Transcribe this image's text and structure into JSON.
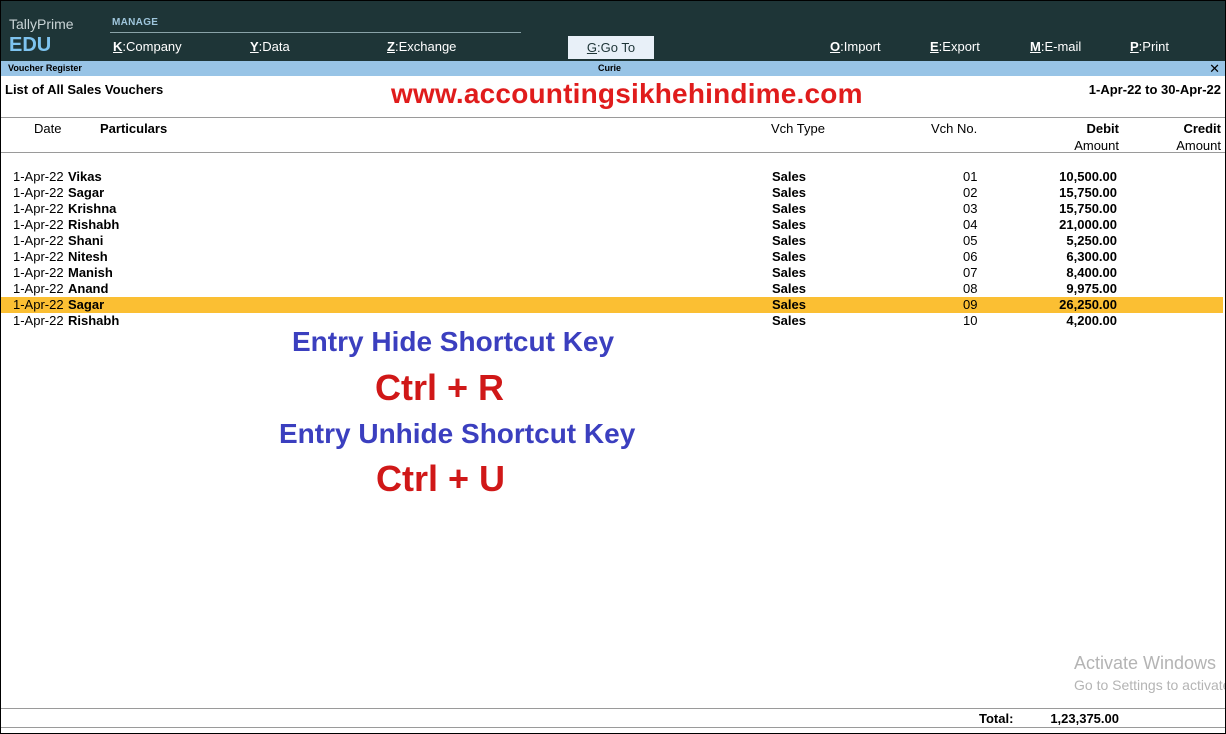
{
  "app": {
    "name": "TallyPrime",
    "edition": "EDU"
  },
  "topmenu": {
    "section_label": "MANAGE",
    "items": [
      {
        "key": "K",
        "label": "Company"
      },
      {
        "key": "Y",
        "label": "Data"
      },
      {
        "key": "Z",
        "label": "Exchange"
      }
    ],
    "goto": {
      "key": "G",
      "label": "Go To"
    },
    "right_items": [
      {
        "key": "O",
        "label": "Import"
      },
      {
        "key": "E",
        "label": "Export"
      },
      {
        "key": "M",
        "label": "E-mail"
      },
      {
        "key": "P",
        "label": "Print"
      }
    ]
  },
  "titlebar": {
    "report": "Voucher Register",
    "company": "Curie",
    "close": "✕"
  },
  "report": {
    "title": "List of All Sales Vouchers",
    "period": "1-Apr-22 to 30-Apr-22",
    "watermark": "www.accountingsikhehindime.com"
  },
  "columns": {
    "date": "Date",
    "particulars": "Particulars",
    "vch_type": "Vch Type",
    "vch_no": "Vch No.",
    "debit": "Debit",
    "debit_sub": "Amount",
    "credit": "Credit",
    "credit_sub": "Amount"
  },
  "rows": [
    {
      "date": "1-Apr-22",
      "particulars": "Vikas",
      "type": "Sales",
      "no": "01",
      "debit": "10,500.00"
    },
    {
      "date": "1-Apr-22",
      "particulars": "Sagar",
      "type": "Sales",
      "no": "02",
      "debit": "15,750.00"
    },
    {
      "date": "1-Apr-22",
      "particulars": "Krishna",
      "type": "Sales",
      "no": "03",
      "debit": "15,750.00"
    },
    {
      "date": "1-Apr-22",
      "particulars": "Rishabh",
      "type": "Sales",
      "no": "04",
      "debit": "21,000.00"
    },
    {
      "date": "1-Apr-22",
      "particulars": "Shani",
      "type": "Sales",
      "no": "05",
      "debit": "5,250.00"
    },
    {
      "date": "1-Apr-22",
      "particulars": "Nitesh",
      "type": "Sales",
      "no": "06",
      "debit": "6,300.00"
    },
    {
      "date": "1-Apr-22",
      "particulars": "Manish",
      "type": "Sales",
      "no": "07",
      "debit": "8,400.00"
    },
    {
      "date": "1-Apr-22",
      "particulars": "Anand",
      "type": "Sales",
      "no": "08",
      "debit": "9,975.00"
    },
    {
      "date": "1-Apr-22",
      "particulars": "Sagar",
      "type": "Sales",
      "no": "09",
      "debit": "26,250.00"
    },
    {
      "date": "1-Apr-22",
      "particulars": "Rishabh",
      "type": "Sales",
      "no": "10",
      "debit": "4,200.00"
    }
  ],
  "selected_row": 8,
  "overlay": {
    "hide_title": "Entry Hide Shortcut Key",
    "hide_keys": "Ctrl + R",
    "unhide_title": "Entry Unhide Shortcut Key",
    "unhide_keys": "Ctrl + U"
  },
  "footer": {
    "total_label": "Total:",
    "total_value": "1,23,375.00"
  },
  "os_watermark": {
    "line1": "Activate Windows",
    "line2": "Go to Settings to activate Windows."
  },
  "colors": {
    "topbar": "#1e3537",
    "titlebar": "#98c4e6",
    "selection": "#fbbf33",
    "watermark": "#e01c1c",
    "overlay_blue": "#3b3fbf",
    "overlay_red": "#d01818"
  }
}
